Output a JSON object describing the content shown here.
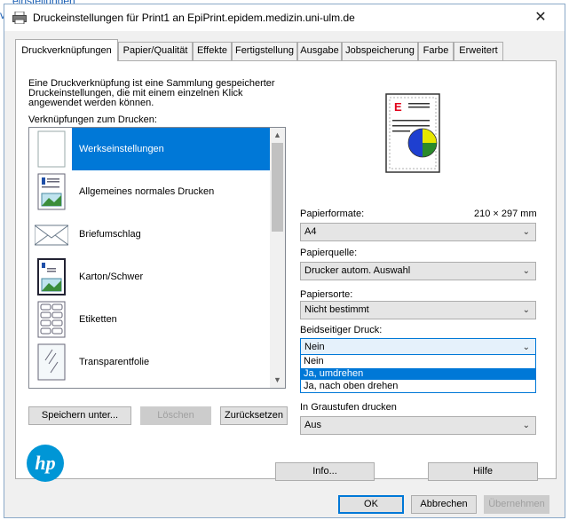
{
  "background_text": {
    "top": "einstellungen",
    "left": "va"
  },
  "window": {
    "title": "Druckeinstellungen für Print1 an EpiPrint.epidem.medizin.uni-ulm.de",
    "close": "✕"
  },
  "tabs": [
    {
      "label": "Druckverknüpfungen",
      "active": true
    },
    {
      "label": "Papier/Qualität"
    },
    {
      "label": "Effekte"
    },
    {
      "label": "Fertigstellung"
    },
    {
      "label": "Ausgabe"
    },
    {
      "label": "Jobspeicherung"
    },
    {
      "label": "Farbe"
    },
    {
      "label": "Erweitert"
    }
  ],
  "shortcuts": {
    "description": "Eine Druckverknüpfung ist eine Sammlung gespeicherter Druckeinstellungen, die mit einem einzelnen Klick angewendet werden können.",
    "list_label": "Verknüpfungen zum Drucken:",
    "items": [
      {
        "label": "Werkseinstellungen",
        "icon": "blank-page-icon",
        "selected": true
      },
      {
        "label": "Allgemeines normales Drucken",
        "icon": "document-image-icon"
      },
      {
        "label": "Briefumschlag",
        "icon": "envelope-icon"
      },
      {
        "label": "Karton/Schwer",
        "icon": "cardstock-icon"
      },
      {
        "label": "Etiketten",
        "icon": "labels-icon"
      },
      {
        "label": "Transparentfolie",
        "icon": "transparency-icon"
      }
    ],
    "scroll_up": "▲",
    "scroll_down": "▼",
    "save_as_label": "Speichern unter...",
    "delete_label": "Löschen",
    "reset_label": "Zurücksetzen"
  },
  "settings": {
    "paper_format_label": "Papierformate:",
    "paper_format_dims": "210 × 297 mm",
    "paper_format_value": "A4",
    "paper_source_label": "Papierquelle:",
    "paper_source_value": "Drucker autom. Auswahl",
    "paper_type_label": "Papiersorte:",
    "paper_type_value": "Nicht bestimmt",
    "duplex_label": "Beidseitiger Druck:",
    "duplex_value": "Nein",
    "duplex_options": [
      "Nein",
      "Ja, umdrehen",
      "Ja, nach oben drehen"
    ],
    "duplex_highlighted_index": 1,
    "grayscale_label": "In Graustufen drucken",
    "grayscale_value": "Aus",
    "chevron": "⌄"
  },
  "preview": {
    "letter": "E",
    "letter_color": "#e2001a"
  },
  "logo": {
    "text": "hp",
    "color": "#0096d6"
  },
  "bottom_buttons": {
    "info": "Info...",
    "help": "Hilfe",
    "ok": "OK",
    "cancel": "Abbrechen",
    "apply": "Übernehmen"
  },
  "colors": {
    "accent": "#0078d7",
    "selection": "#0078d7"
  }
}
